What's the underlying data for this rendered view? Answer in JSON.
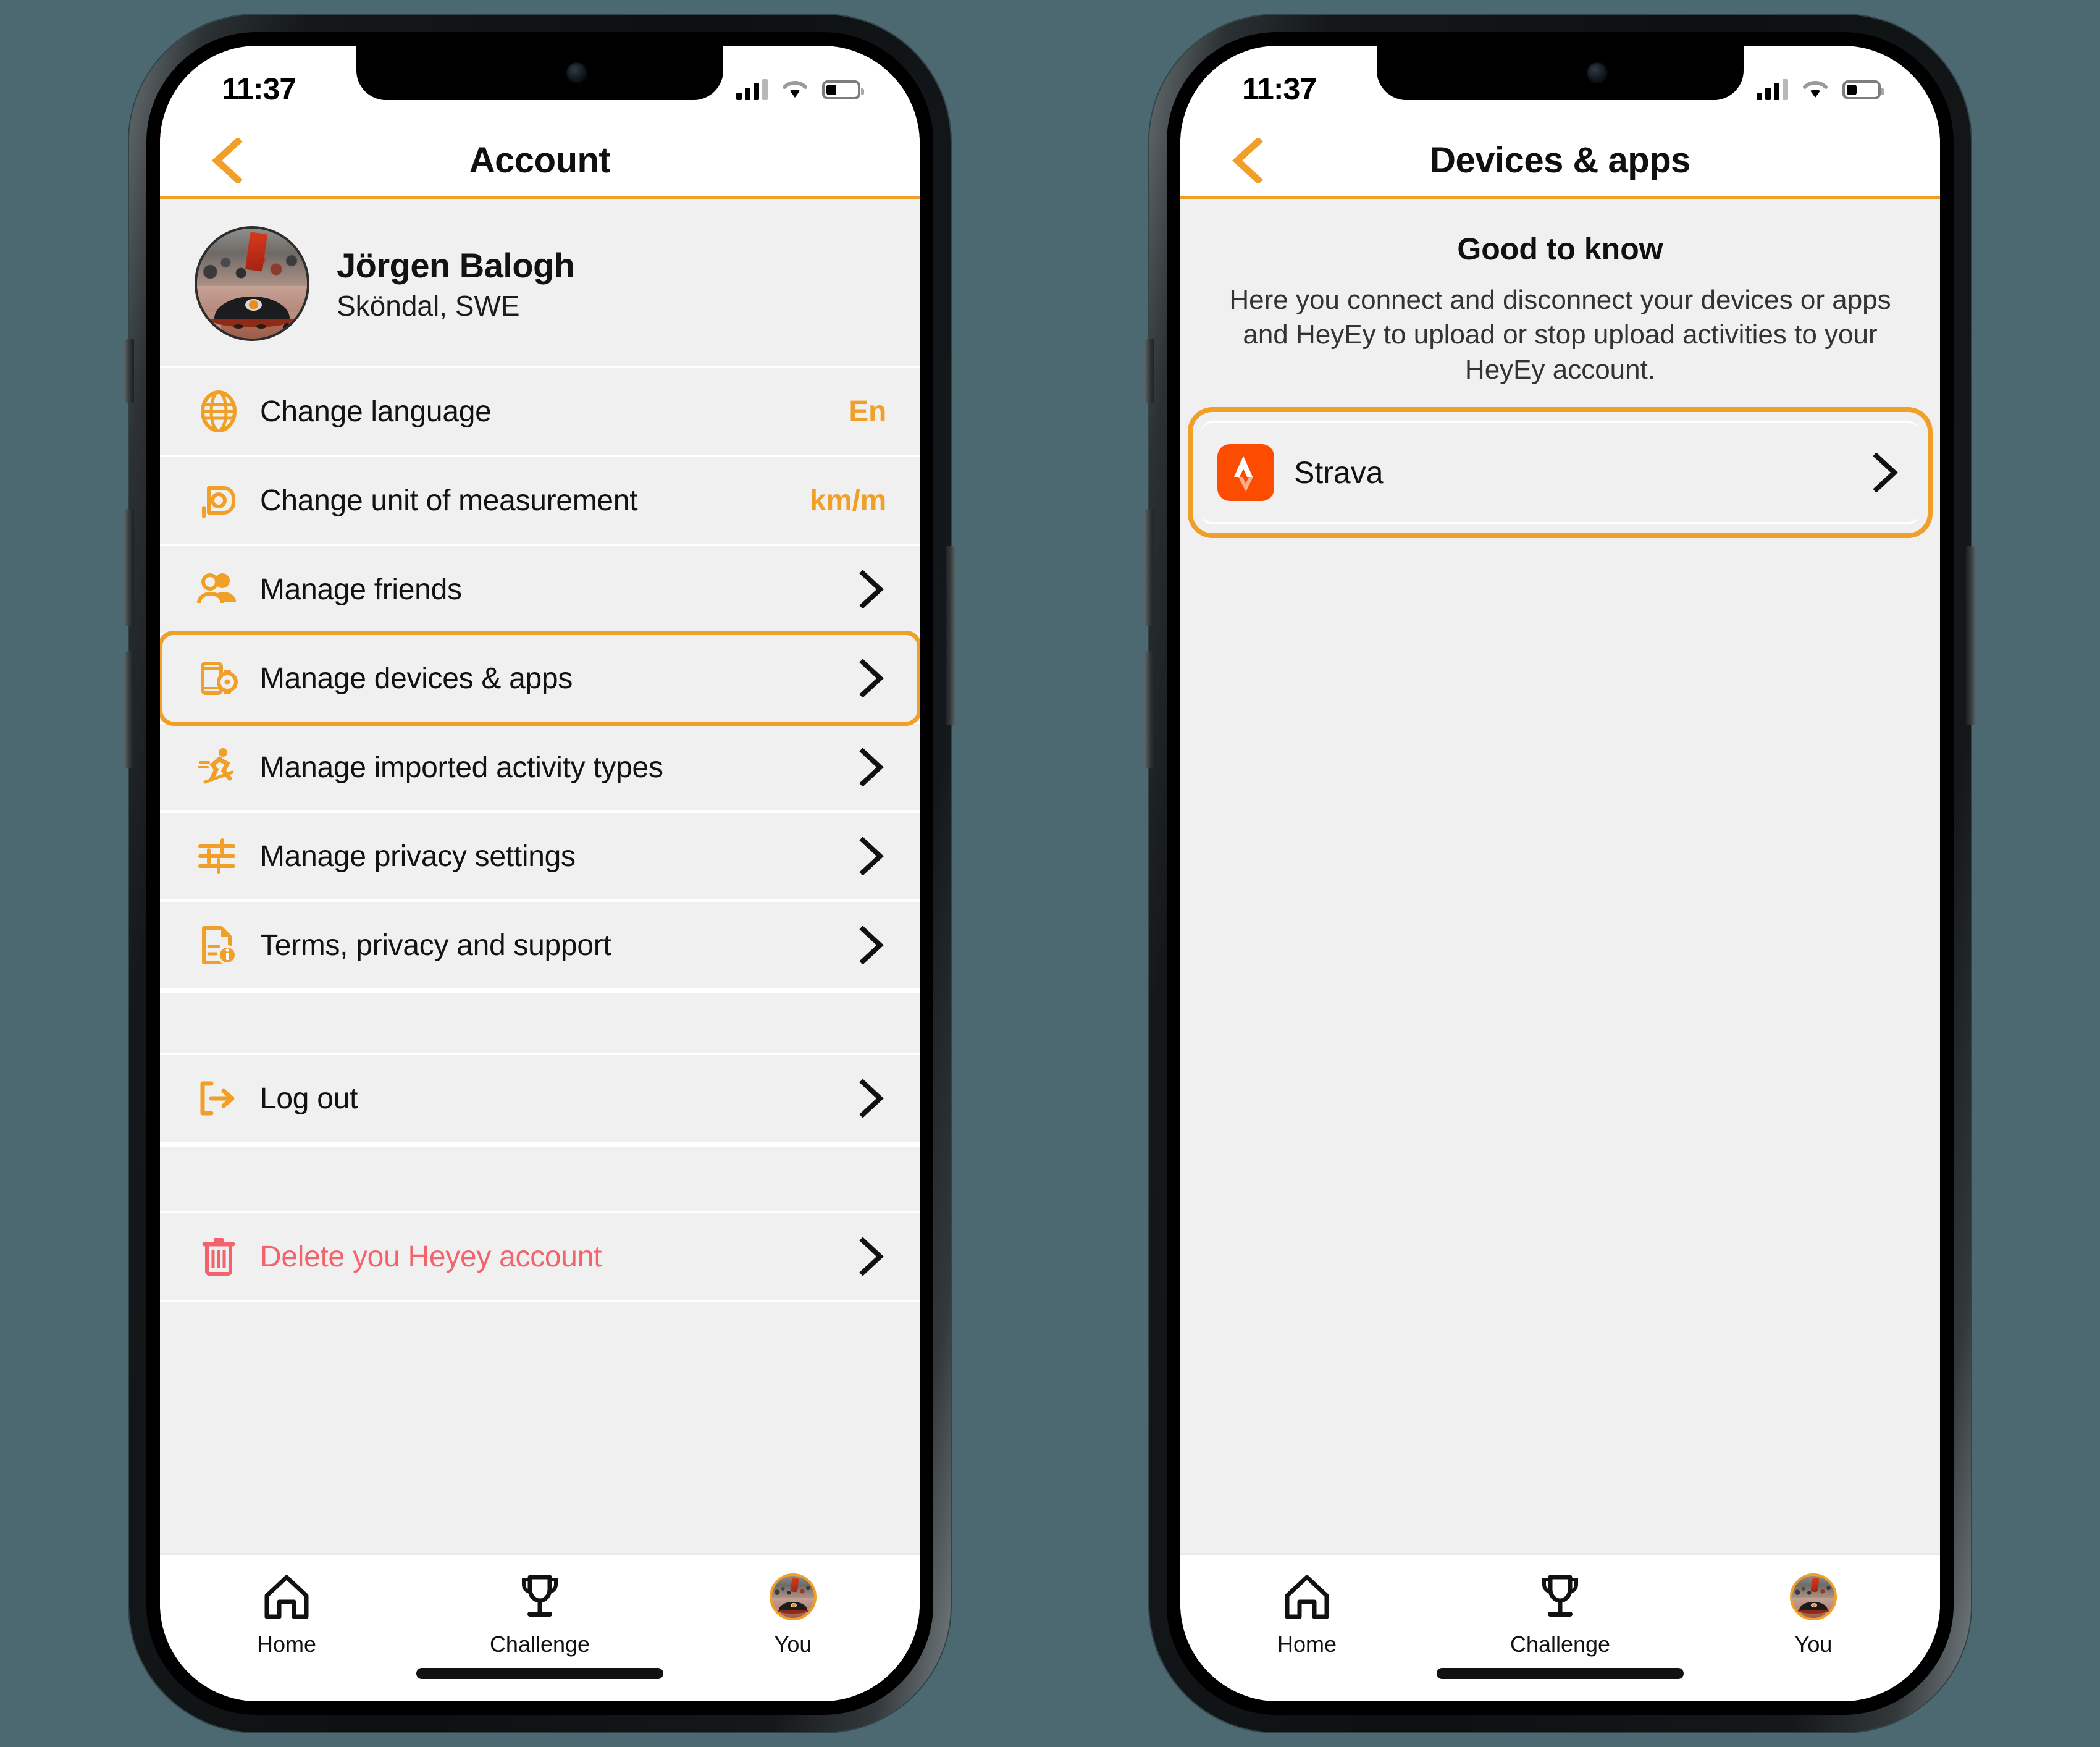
{
  "theme": {
    "accent": "#f0a028",
    "danger": "#f2636c",
    "strava_orange": "#fc4c02",
    "page_background": "#4c6870",
    "content_background": "#f0f0f0"
  },
  "left_phone": {
    "status_bar": {
      "time": "11:37",
      "cellular_icon": "cellular-bars-icon",
      "wifi_icon": "wifi-icon",
      "battery_icon": "battery-icon"
    },
    "nav": {
      "back_icon": "chevron-left-icon",
      "title": "Account"
    },
    "profile": {
      "avatar_icon": "user-avatar-photo",
      "name": "Jörgen Balogh",
      "location": "Sköndal, SWE"
    },
    "settings_rows": [
      {
        "icon": "globe-icon",
        "label": "Change language",
        "value": "En",
        "accessory": "value"
      },
      {
        "icon": "measure-gauge-icon",
        "label": "Change unit of measurement",
        "value": "km/m",
        "accessory": "value"
      },
      {
        "icon": "people-icon",
        "label": "Manage friends",
        "value": "",
        "accessory": "chevron"
      },
      {
        "icon": "phone-watch-icon",
        "label": "Manage devices & apps",
        "value": "",
        "accessory": "chevron",
        "highlighted": true
      },
      {
        "icon": "runner-icon",
        "label": "Manage imported activity types",
        "value": "",
        "accessory": "chevron"
      },
      {
        "icon": "sliders-icon",
        "label": "Manage privacy settings",
        "value": "",
        "accessory": "chevron"
      },
      {
        "icon": "document-info-icon",
        "label": "Terms, privacy and support",
        "value": "",
        "accessory": "chevron"
      }
    ],
    "logout_row": {
      "icon": "logout-arrow-icon",
      "label": "Log out",
      "accessory": "chevron"
    },
    "delete_row": {
      "icon": "trash-icon",
      "label": "Delete you Heyey account",
      "accessory": "chevron"
    },
    "tabs": [
      {
        "icon": "home-icon",
        "label": "Home"
      },
      {
        "icon": "trophy-icon",
        "label": "Challenge"
      },
      {
        "icon": "user-avatar-photo",
        "label": "You"
      }
    ]
  },
  "right_phone": {
    "status_bar": {
      "time": "11:37",
      "cellular_icon": "cellular-bars-icon",
      "wifi_icon": "wifi-icon",
      "battery_icon": "battery-icon"
    },
    "nav": {
      "back_icon": "chevron-left-icon",
      "title": "Devices & apps"
    },
    "info": {
      "heading": "Good to know",
      "body": "Here you connect and disconnect your devices or apps and HeyEy to upload or stop upload activities to your HeyEy account."
    },
    "connected_apps": [
      {
        "icon": "strava-icon",
        "name": "Strava",
        "accessory": "chevron",
        "highlighted": true
      }
    ],
    "tabs": [
      {
        "icon": "home-icon",
        "label": "Home"
      },
      {
        "icon": "trophy-icon",
        "label": "Challenge"
      },
      {
        "icon": "user-avatar-photo",
        "label": "You"
      }
    ]
  }
}
